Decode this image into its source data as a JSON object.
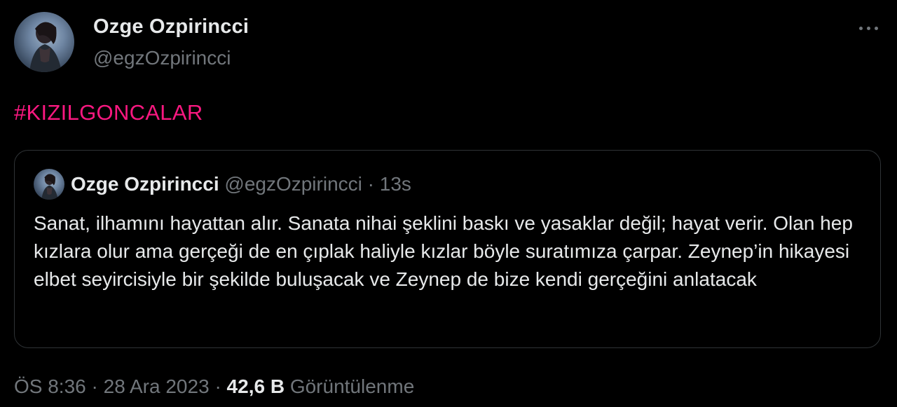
{
  "author": {
    "name": "Ozge Ozpirincci",
    "handle": "@egzOzpirincci"
  },
  "more_icon": "more-horizontal-icon",
  "tweet": {
    "hashtag": "#KIZILGONCALAR"
  },
  "quoted": {
    "name": "Ozge Ozpirincci",
    "handle": "@egzOzpirincci",
    "separator": "·",
    "time": "13s",
    "text": "Sanat, ilhamını hayattan alır. Sanata nihai şeklini baskı ve yasaklar değil; hayat verir. Olan hep kızlara olur ama gerçeği de en çıplak haliyle kızlar böyle suratımıza çarpar. Zeynep’in hikayesi elbet seyircisiyle bir şekilde buluşacak ve Zeynep de bize kendi gerçeğini anlatacak"
  },
  "meta": {
    "time": "ÖS 8:36",
    "separator1": "·",
    "date": "28 Ara 2023",
    "separator2": "·",
    "views_count": "42,6 B",
    "views_label": "Görüntülenme"
  },
  "colors": {
    "background": "#000000",
    "text_primary": "#e7e9ea",
    "text_secondary": "#71767b",
    "hashtag": "#f91880",
    "border": "#2f3336"
  }
}
